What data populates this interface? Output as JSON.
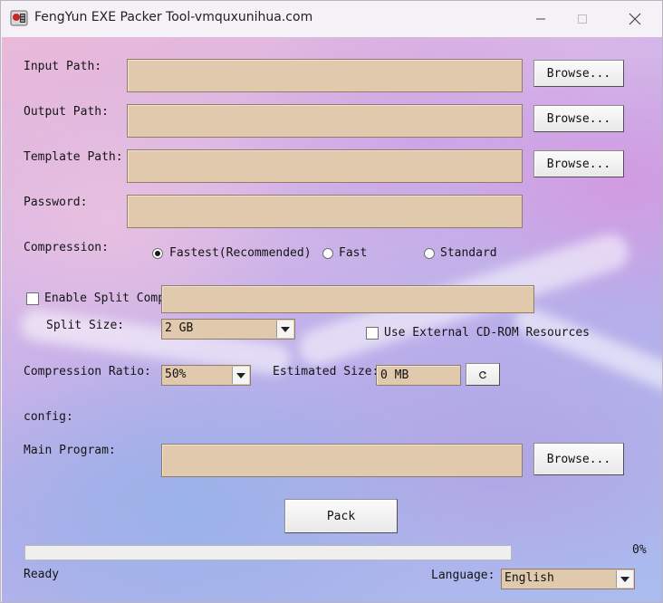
{
  "window": {
    "title": "FengYun EXE Packer Tool-vmquxunihua.com",
    "icons": {
      "app": "app-icon",
      "minimize": "minimize-icon",
      "maximize": "maximize-icon",
      "close": "close-icon"
    }
  },
  "form": {
    "input_path": {
      "label": "Input Path:",
      "value": "",
      "browse": "Browse..."
    },
    "output_path": {
      "label": "Output Path:",
      "value": "",
      "browse": "Browse..."
    },
    "template_path": {
      "label": "Template Path:",
      "value": "",
      "browse": "Browse..."
    },
    "password": {
      "label": "Password:",
      "value": ""
    },
    "compression": {
      "label": "Compression:",
      "options": [
        "Fastest(Recommended)",
        "Fast",
        "Standard"
      ],
      "selected": "Fastest(Recommended)"
    },
    "split": {
      "enable_label": "Enable Split Comp",
      "enabled": false,
      "value": "",
      "size_label": "Split Size:",
      "size_value": "2 GB",
      "external_label": "Use External CD-ROM Resources",
      "external_enabled": false
    },
    "ratio": {
      "label": "Compression Ratio:",
      "value": "50%",
      "estimated_label": "Estimated Size:",
      "estimated_value": "0 MB",
      "refresh_icon": "refresh-icon"
    },
    "config_label": "config:",
    "main_program": {
      "label": "Main Program:",
      "value": "",
      "browse": "Browse..."
    },
    "pack_label": "Pack"
  },
  "status": {
    "progress_text": "0%",
    "progress_fraction": 0,
    "status_text": "Ready",
    "language_label": "Language:",
    "language_value": "English"
  }
}
